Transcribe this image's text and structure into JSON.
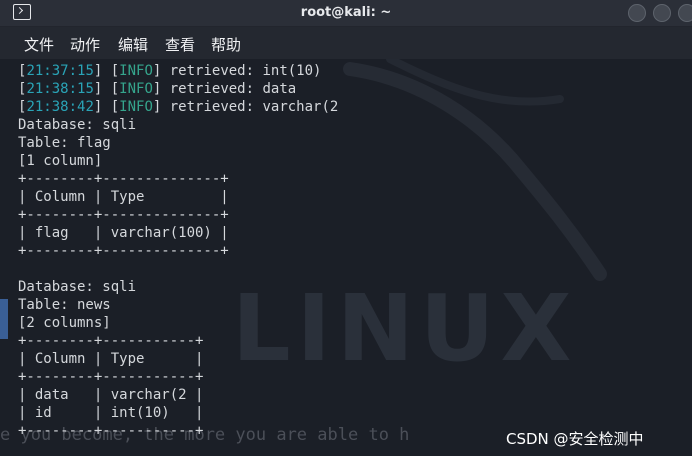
{
  "window": {
    "title": "root@kali: ~",
    "icon": "terminal-icon"
  },
  "menu": [
    "文件",
    "动作",
    "编辑",
    "查看",
    "帮助"
  ],
  "log": [
    {
      "time": "21:37:15",
      "level": "INFO",
      "message": "retrieved: int(10)"
    },
    {
      "time": "21:38:15",
      "level": "INFO",
      "message": "retrieved: data"
    },
    {
      "time": "21:38:42",
      "level": "INFO",
      "message": "retrieved: varchar(2"
    }
  ],
  "output_lines": [
    "Database: sqli",
    "Table: flag",
    "[1 column]",
    "+--------+--------------+",
    "| Column | Type         |",
    "+--------+--------------+",
    "| flag   | varchar(100) |",
    "+--------+--------------+",
    "",
    "Database: sqli",
    "Table: news",
    "[2 columns]",
    "+--------+-----------+",
    "| Column | Type      |",
    "+--------+-----------+",
    "| data   | varchar(2 |",
    "| id     | int(10)   |",
    "+--------+-----------+"
  ],
  "wallpaper": {
    "watermark_text": "LINUX",
    "quote_fragment": "e you become, the more you are able to h"
  },
  "overlay_watermark": "CSDN @安全检测中",
  "colors": {
    "timestamp": "#2aa4b7",
    "info": "#35a58d",
    "text": "#d5d8dc",
    "background": "#1b1f27"
  }
}
